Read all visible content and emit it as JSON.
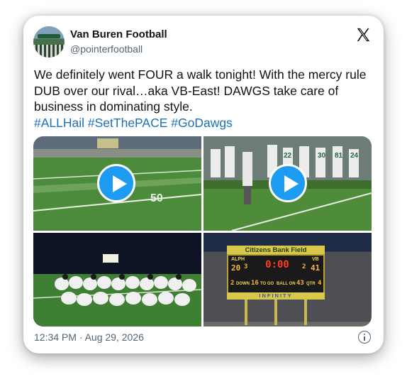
{
  "author": {
    "name": "Van Buren Football",
    "handle": "@pointerfootball",
    "avatar_icon": "team-photo-avatar"
  },
  "platform_icon": "x-logo-icon",
  "tweet": {
    "text": "We definitely went FOUR a walk tonight! With the mercy rule DUB over our rival…aka VB-East! DAWGS take care of business in dominating style.",
    "hashtags": [
      "#ALLHail",
      "#SetThePACE",
      "#GoDawgs"
    ]
  },
  "media": [
    {
      "kind": "video",
      "description_icon": "play-icon"
    },
    {
      "kind": "video",
      "description_icon": "play-icon"
    },
    {
      "kind": "image"
    },
    {
      "kind": "image"
    }
  ],
  "scoreboard": {
    "sponsor": "Citizens Bank Field",
    "clock": "0:00",
    "home_label": "ALPH",
    "home_score": "20",
    "away_label": "VB",
    "away_score": "41",
    "down": "2",
    "down_label": "DOWN",
    "to_go": "16",
    "to_go_label": "TO GO",
    "ball_on": "43",
    "ball_on_label": "BALL ON",
    "qtr": "4",
    "qtr_label": "QTR",
    "brand": "INFINITY",
    "home_tol": "3",
    "away_tol": "2"
  },
  "footer": {
    "timestamp": "12:34 PM · Aug 29, 2026",
    "info_icon": "info-icon"
  },
  "colors": {
    "link": "#1d6fb8",
    "play": "#1d9bf0",
    "secondary_text": "#536471"
  }
}
